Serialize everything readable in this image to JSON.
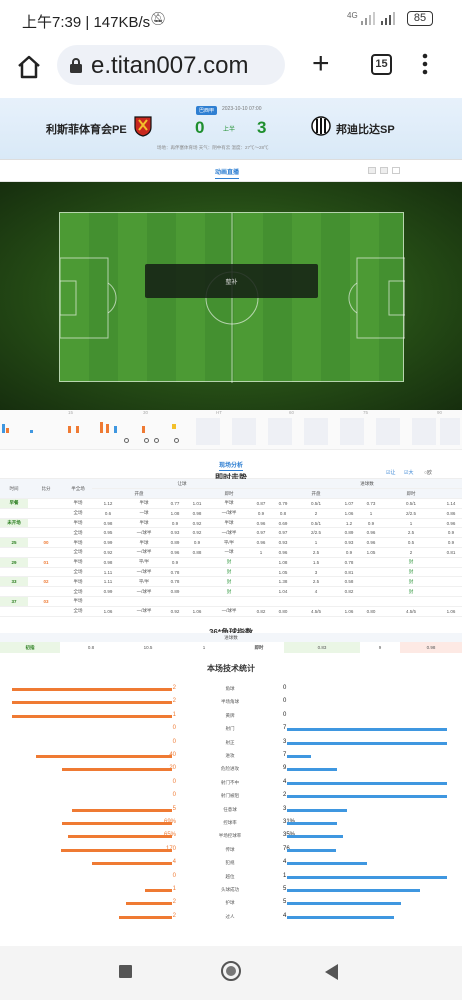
{
  "status": {
    "time": "上午7:39",
    "speed": "147KB/s",
    "net": "4G",
    "battery": "85"
  },
  "browser": {
    "url": "e.titan007.com",
    "tabs": "15"
  },
  "match": {
    "league": "巴西甲",
    "datetime": "2023-10-10 07:00",
    "home": "利斯菲体育会PE",
    "away": "邦迪比达SP",
    "home_score": "0",
    "away_score": "3",
    "half": "上半",
    "info": "场地：再伴塞体育场 天气：阴中有云 温度：27℃～28℃"
  },
  "live": {
    "title": "动画直播",
    "overlay": "整补"
  },
  "timeline": {
    "labels": [
      "15",
      "30",
      "HT",
      "60",
      "75",
      "90"
    ]
  },
  "analysis": {
    "tab": "现场分析",
    "odds_title": "即时走势",
    "options": [
      "让",
      "大",
      "欧"
    ]
  },
  "odds": {
    "h1": [
      "时间",
      "比分",
      "半全场",
      "让球",
      "进球数"
    ],
    "h2": [
      "开盘",
      "即时",
      "开盘",
      "即时"
    ],
    "rows": [
      [
        "早餐",
        "",
        "半场",
        "1.12",
        "半球",
        "0.77",
        "1.01",
        "半球",
        "0.87",
        "0.79",
        "0.5/1",
        "1.07",
        "0.73",
        "0.5/1",
        "1.14"
      ],
      [
        "",
        "",
        "全场",
        "0.6",
        "一球",
        "1.08",
        "0.98",
        "一/球半",
        "0.9",
        "0.8",
        "2",
        "1.06",
        "1",
        "2/2.5",
        "0.86"
      ],
      [
        "未开场",
        "",
        "半场",
        "0.98",
        "半球",
        "0.9",
        "0.92",
        "半球",
        "0.96",
        "0.69",
        "0.5/1",
        "1.2",
        "0.9",
        "1",
        "0.96"
      ],
      [
        "",
        "",
        "全场",
        "0.95",
        "一/球半",
        "0.93",
        "0.92",
        "一/球半",
        "0.97",
        "0.97",
        "2/2.5",
        "0.89",
        "0.96",
        "2.5",
        "0.9"
      ],
      [
        "25",
        "00",
        "半场",
        "0.99",
        "半球",
        "0.89",
        "0.9",
        "平/半",
        "0.96",
        "0.93",
        "1",
        "0.93",
        "0.96",
        "0.5",
        "0.9"
      ],
      [
        "",
        "",
        "全场",
        "0.92",
        "一/球半",
        "0.96",
        "0.88",
        "一球",
        "1",
        "0.96",
        "2.5",
        "0.9",
        "1.05",
        "2",
        "0.81"
      ],
      [
        "29",
        "01",
        "半场",
        "0.98",
        "平/半",
        "0.9",
        "",
        "封",
        "",
        "1.08",
        "1.5",
        "0.78",
        "",
        "封",
        ""
      ],
      [
        "",
        "",
        "全场",
        "1.11",
        "一/球半",
        "0.78",
        "",
        "封",
        "",
        "1.05",
        "3",
        "0.81",
        "",
        "封",
        ""
      ],
      [
        "33",
        "02",
        "半场",
        "1.11",
        "平/半",
        "0.78",
        "",
        "封",
        "",
        "1.38",
        "2.5",
        "0.58",
        "",
        "封",
        ""
      ],
      [
        "",
        "",
        "全场",
        "0.99",
        "一/球半",
        "0.89",
        "",
        "封",
        "",
        "1.04",
        "4",
        "0.82",
        "",
        "封",
        ""
      ],
      [
        "37",
        "03",
        "半场",
        "",
        "",
        "",
        "",
        "",
        "",
        "",
        "",
        "",
        "",
        "",
        ""
      ],
      [
        "",
        "",
        "全场",
        "1.06",
        "一/球半",
        "0.92",
        "1.06",
        "一/球半",
        "0.82",
        "0.80",
        "4.5/5",
        "1.06",
        "0.80",
        "4.5/5",
        "1.06"
      ]
    ]
  },
  "corner": {
    "title": "36*角球指数",
    "sub": "进球数",
    "first_label": "初指",
    "first": [
      "0.8",
      "10.5",
      "1"
    ],
    "now_label": "即时",
    "now": [
      "0.83",
      "9",
      "0.98"
    ]
  },
  "stats": {
    "title": "本场技术统计",
    "rows": [
      {
        "label": "角球",
        "home": "2",
        "away": "0",
        "h": 2,
        "a": 0
      },
      {
        "label": "半场角球",
        "home": "2",
        "away": "0",
        "h": 2,
        "a": 0
      },
      {
        "label": "黄牌",
        "home": "1",
        "away": "0",
        "h": 1,
        "a": 0
      },
      {
        "label": "射门",
        "home": "0",
        "away": "7",
        "h": 0,
        "a": 7
      },
      {
        "label": "射正",
        "home": "0",
        "away": "3",
        "h": 0,
        "a": 3
      },
      {
        "label": "进攻",
        "home": "40",
        "away": "7",
        "h": 40,
        "a": 7
      },
      {
        "label": "危险进攻",
        "home": "20",
        "away": "9",
        "h": 20,
        "a": 9
      },
      {
        "label": "射门不中",
        "home": "0",
        "away": "4",
        "h": 0,
        "a": 4
      },
      {
        "label": "射门被阻",
        "home": "0",
        "away": "2",
        "h": 0,
        "a": 2
      },
      {
        "label": "任意球",
        "home": "5",
        "away": "3",
        "h": 5,
        "a": 3
      },
      {
        "label": "控球率",
        "home": "69%",
        "away": "31%",
        "h": 69,
        "a": 31
      },
      {
        "label": "半场控球率",
        "home": "65%",
        "away": "35%",
        "h": 65,
        "a": 35
      },
      {
        "label": "传球",
        "home": "170",
        "away": "76",
        "h": 170,
        "a": 76
      },
      {
        "label": "犯规",
        "home": "4",
        "away": "4",
        "h": 4,
        "a": 4
      },
      {
        "label": "越位",
        "home": "0",
        "away": "1",
        "h": 0,
        "a": 1
      },
      {
        "label": "头球成功",
        "home": "1",
        "away": "5",
        "h": 1,
        "a": 5
      },
      {
        "label": "护球",
        "home": "2",
        "away": "5",
        "h": 2,
        "a": 5
      },
      {
        "label": "过人",
        "home": "2",
        "away": "4",
        "h": 2,
        "a": 4
      }
    ]
  },
  "colors": {
    "home": "#ef7a33",
    "away": "#3f97e0",
    "accent": "#2f7fd2",
    "score": "#1f8f2e"
  }
}
